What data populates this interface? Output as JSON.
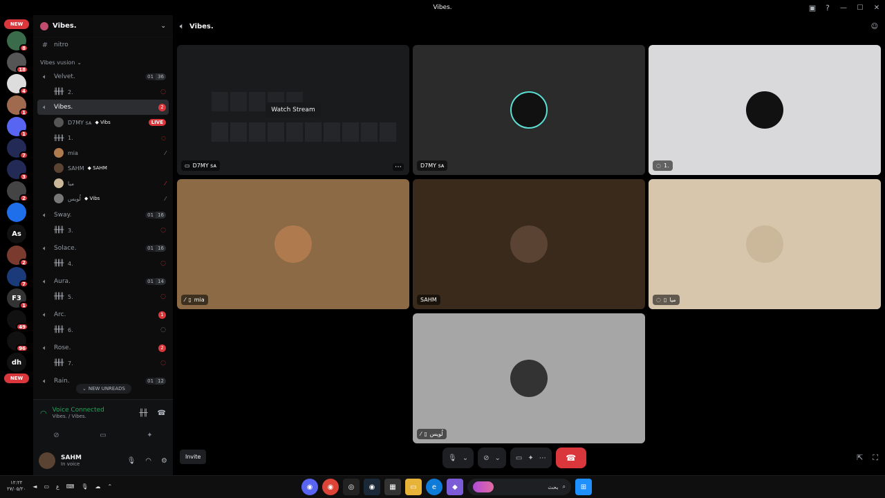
{
  "titlebar": {
    "title": "Vibes."
  },
  "rail": {
    "new_top": "NEW",
    "new_bottom": "NEW",
    "servers": [
      {
        "badge": "8",
        "bg": "#3a6b4a",
        "text": ""
      },
      {
        "badge": "18",
        "bg": "#555",
        "text": ""
      },
      {
        "badge": "4",
        "bg": "#ddd",
        "text": ""
      },
      {
        "badge": "1",
        "bg": "#a06a4f",
        "text": ""
      },
      {
        "badge": "1",
        "bg": "#5865f2",
        "text": ""
      },
      {
        "badge": "7",
        "bg": "#222a55",
        "text": ""
      },
      {
        "badge": "3",
        "bg": "#222a55",
        "text": ""
      },
      {
        "badge": "2",
        "bg": "#444",
        "text": ""
      },
      {
        "badge": "",
        "bg": "#1f6feb",
        "text": ""
      },
      {
        "badge": "",
        "bg": "#111",
        "text": "As"
      },
      {
        "badge": "2",
        "bg": "#7a3b2e",
        "text": ""
      },
      {
        "badge": "7",
        "bg": "#1a3a7a",
        "text": ""
      },
      {
        "badge": "1",
        "bg": "#333",
        "text": "F3"
      },
      {
        "badge": "49",
        "bg": "#111",
        "text": ""
      },
      {
        "badge": "96",
        "bg": "#111",
        "text": ""
      },
      {
        "badge": "",
        "bg": "#111",
        "text": "dh"
      }
    ]
  },
  "guild": {
    "name": "Vibes.",
    "channel_nitro": "nitro",
    "category": "Vibes vusion",
    "channels": [
      {
        "name": "Velvet.",
        "count_a": "01",
        "count_b": "36",
        "sub": "2."
      },
      {
        "name": "Vibes.",
        "badge": "2"
      },
      {
        "name": "Sway.",
        "count_a": "01",
        "count_b": "16",
        "sub": "3."
      },
      {
        "name": "Solace.",
        "count_a": "01",
        "count_b": "16",
        "sub": "4."
      },
      {
        "name": "Aura.",
        "count_a": "01",
        "count_b": "14",
        "sub": "5."
      },
      {
        "name": "Arc.",
        "badge": "1",
        "sub": "6."
      },
      {
        "name": "Rose.",
        "badge": "2",
        "sub": "7."
      },
      {
        "name": "Rain.",
        "count_a": "01",
        "count_b": "12"
      }
    ],
    "vibes_members": [
      {
        "name": "D7MY sᴀ",
        "tag": "Vibs",
        "live": "LIVE"
      },
      {
        "name": "1."
      },
      {
        "name": "mia"
      },
      {
        "name": "SAHM",
        "tag": "SAHM"
      },
      {
        "name": "ميا"
      },
      {
        "name": "لُويس",
        "tag": "Vibs"
      }
    ],
    "new_unreads": "NEW UNREADS"
  },
  "voice": {
    "status": "Voice Connected",
    "location": "Vibes. / Vibes."
  },
  "user": {
    "name": "SAHM",
    "status": "In voice"
  },
  "main": {
    "channel": "Vibes.",
    "watch_stream": "Watch Stream",
    "tiles": [
      {
        "name": "D7MY sᴀ",
        "bg": "#1a1b1d"
      },
      {
        "name": "D7MY sᴀ",
        "bg": "#2b2b2b"
      },
      {
        "name": "1.",
        "bg": "#d9d9db"
      },
      {
        "name": "mia",
        "bg": "#8b6a45"
      },
      {
        "name": "SAHM",
        "bg": "#3a2a1c"
      },
      {
        "name": "ميا",
        "bg": "#d7c6ab"
      },
      {
        "name": "لُويس",
        "bg": "#a6a6a6"
      }
    ],
    "invite": "Invite"
  },
  "taskbar": {
    "time": "١٢:٢٢",
    "date": "٢٧/٠٥/٢٠",
    "lang": "ع",
    "search": "بحث"
  }
}
